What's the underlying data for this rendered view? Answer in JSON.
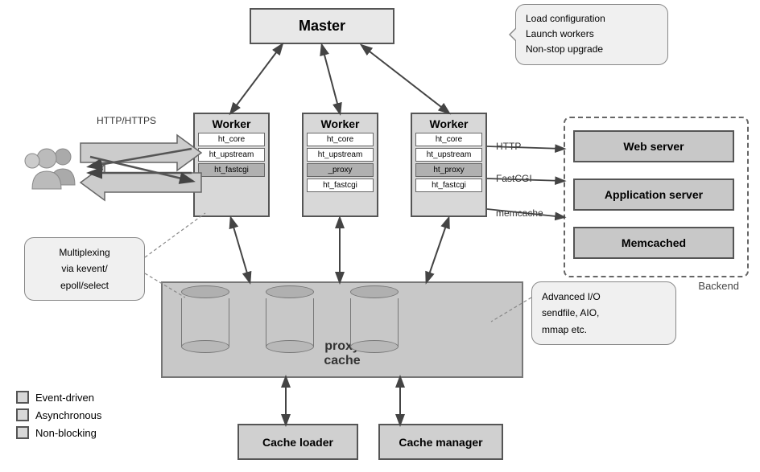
{
  "master": {
    "label": "Master"
  },
  "callout_top": {
    "line1": "Load configuration",
    "line2": "Launch workers",
    "line3": "Non-stop upgrade"
  },
  "workers": [
    {
      "id": "worker1",
      "title": "Worker",
      "modules": [
        "ht_core",
        "ht_upstream",
        "ht_fastcgi"
      ]
    },
    {
      "id": "worker2",
      "title": "Worker",
      "modules": [
        "ht_core",
        "ht_upstream",
        "_proxy",
        "ht_fastcgi"
      ]
    },
    {
      "id": "worker3",
      "title": "Worker",
      "modules": [
        "ht_core",
        "ht_upstream",
        "ht_proxy",
        "ht_fastcgi"
      ]
    }
  ],
  "backend": {
    "label": "Backend",
    "servers": [
      {
        "label": "Web server"
      },
      {
        "label": "Application server"
      },
      {
        "label": "Memcached"
      }
    ]
  },
  "proxy_cache": {
    "label": "proxy\ncache"
  },
  "cache_loader": {
    "label": "Cache loader"
  },
  "cache_manager": {
    "label": "Cache manager"
  },
  "callout_left": {
    "text": "Multiplexing\nvia kevent/\nepoll/select"
  },
  "callout_bottom": {
    "line1": "Advanced I/O",
    "line2": "sendfile, AIO,",
    "line3": "mmap etc."
  },
  "labels": {
    "http_https": "HTTP/HTTPS",
    "http": "HTTP",
    "fastcgi": "FastCGI",
    "memcache": "memcache"
  },
  "legend": {
    "items": [
      {
        "label": "Event-driven"
      },
      {
        "label": "Asynchronous"
      },
      {
        "label": "Non-blocking"
      }
    ]
  }
}
